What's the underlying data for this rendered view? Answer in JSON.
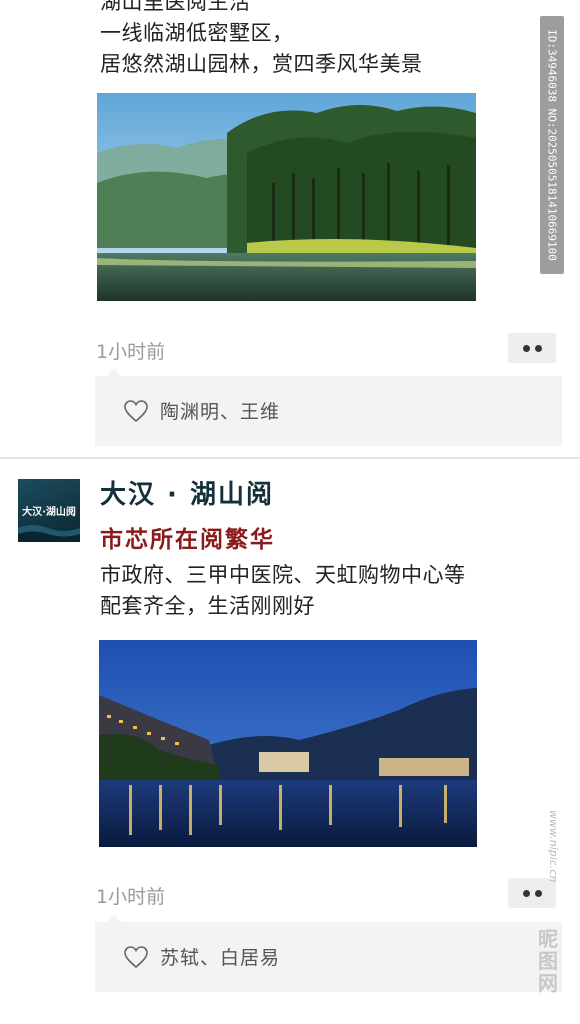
{
  "post1": {
    "lines": [
      "湖山里医阅生活",
      "一线临湖低密墅区，",
      "居悠然湖山园林，赏四季风华美景"
    ],
    "time": "1小时前",
    "likes": "陶渊明、王维"
  },
  "post2": {
    "author": "大汉 · 湖山阅",
    "avatar_text": "大汉·湖山阅",
    "headline": "市芯所在阅繁华",
    "lines": [
      "市政府、三甲中医院、天虹购物中心等",
      "配套齐全，生活刚刚好"
    ],
    "time": "1小时前",
    "likes": "苏轼、白居易"
  },
  "watermark": {
    "id_text": "ID:34946038 NO:20250505181410669100",
    "site": "www.nipic.cn",
    "brand": "昵图网"
  },
  "icons": {
    "like": "heart-icon",
    "more": "more-dots-icon"
  },
  "colors": {
    "headline": "#8b1a1a",
    "author": "#14303b",
    "like_bg": "#f4f2f4"
  }
}
